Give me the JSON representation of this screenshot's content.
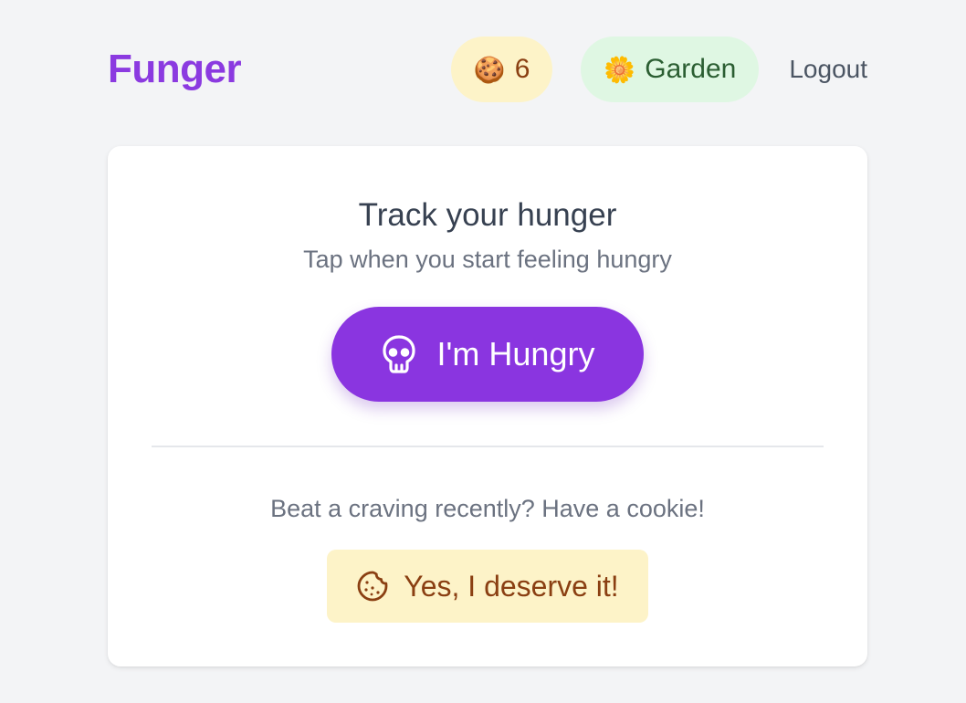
{
  "app": {
    "name": "Funger"
  },
  "header": {
    "cookie_count": "6",
    "cookie_icon": "cookie-emoji",
    "garden_label": "Garden",
    "garden_icon": "flower-emoji",
    "logout_label": "Logout"
  },
  "main": {
    "title": "Track your hunger",
    "subtitle": "Tap when you start feeling hungry",
    "hungry_button_label": "I'm Hungry",
    "hungry_button_icon": "skull-icon",
    "craving_prompt": "Beat a craving recently? Have a cookie!",
    "cookie_button_label": "Yes, I deserve it!",
    "cookie_button_icon": "cookie-icon"
  },
  "colors": {
    "brand": "#8b3ae0",
    "background": "#f3f4f6",
    "cookie_pill_bg": "#fdf3c8",
    "cookie_pill_text": "#8a3f12",
    "garden_pill_bg": "#dff7e3",
    "garden_pill_text": "#2b5e32"
  }
}
